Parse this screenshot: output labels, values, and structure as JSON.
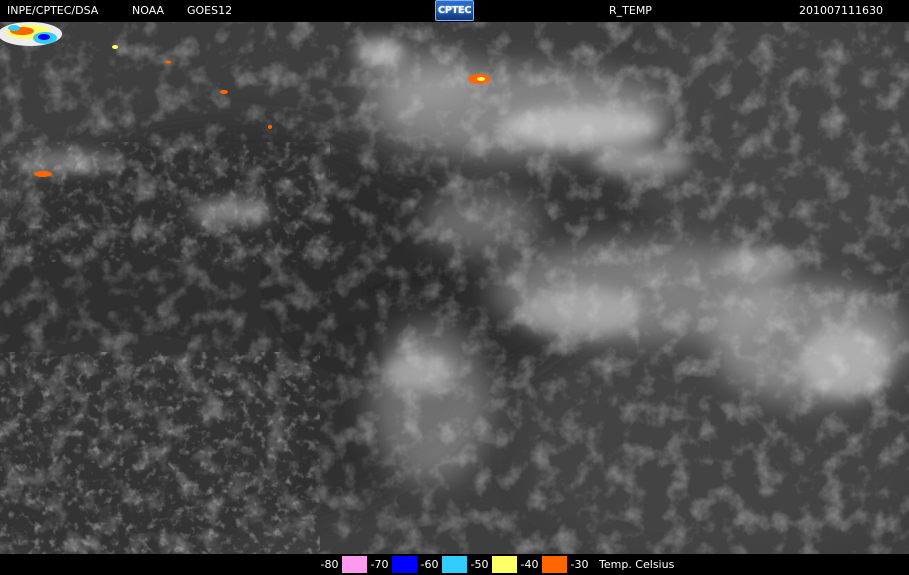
{
  "header": {
    "source": "INPE/CPTEC/DSA",
    "agency": "NOAA",
    "satellite": "GOES12",
    "logo_text": "CPTEC",
    "product": "R_TEMP",
    "timestamp": "201007111630"
  },
  "imagery": {
    "base_color": "#3d3d3d",
    "cloud_color": "#cfcfcf"
  },
  "legend": {
    "unit": "Temp. Celsius",
    "bins": [
      {
        "label": "-80",
        "color": "#ff99ee"
      },
      {
        "label": "-70",
        "color": "#0000ff"
      },
      {
        "label": "-60",
        "color": "#33ccff"
      },
      {
        "label": "-50",
        "color": "#ffff66"
      },
      {
        "label": "-40",
        "color": "#ff6600"
      },
      {
        "label": "-30",
        "color": "#000000"
      }
    ]
  }
}
